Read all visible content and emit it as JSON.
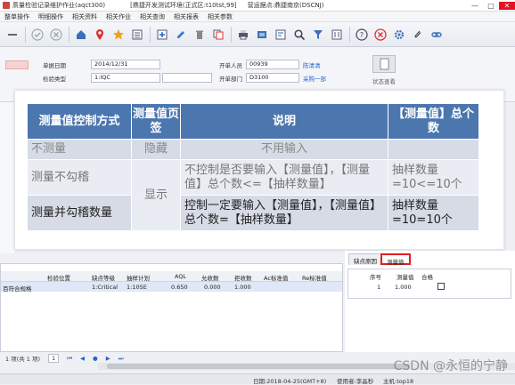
{
  "titlebar": {
    "title": "质量检验记录维护作业(aqct300)",
    "env": "[鼎捷开发测试环境(正式区:t10tst,99]",
    "site": "营运据点:鼎捷南京(DSCNJ)",
    "controls": [
      "—",
      "□",
      "✕"
    ]
  },
  "menu": [
    "整单操作",
    "明细操作",
    "相关资料",
    "相关作业",
    "相关查询",
    "相关报表",
    "相关参数"
  ],
  "toolbar": {
    "icons": [
      "minimize-icon",
      "check-icon",
      "cancel-icon",
      "home-icon",
      "locate-icon",
      "star-icon",
      "list-icon",
      "add-icon",
      "edit-icon",
      "delete-icon",
      "copy-icon",
      "print-icon",
      "export-icon",
      "query-icon",
      "search-icon",
      "filter-icon",
      "sort-icon",
      "help-icon",
      "error-icon",
      "settings-icon",
      "attach-icon",
      "link-icon"
    ]
  },
  "header": {
    "doc_date_label": "单据日期",
    "doc_date": "2014/12/31",
    "inspect_type_label": "检验类型",
    "inspect_type": "1:IQC",
    "opener_label": "开单人员",
    "opener_code": "00939",
    "opener_name": "陈清清",
    "dept_label": "开单部门",
    "dept_code": "D3100",
    "dept_name": "采购一部",
    "side_button": "状态查看"
  },
  "overlay": {
    "headers": [
      "测量值控制方式",
      "测量值页签",
      "说明",
      "【测量值】总个数"
    ],
    "rows": [
      [
        "不测量",
        "隐藏",
        "不用输入",
        ""
      ],
      [
        "测量不勾稽",
        "显示",
        "不控制是否要输入【测量值】，【测量值】总个数<=【抽样数量】",
        "抽样数量=10<=10个"
      ],
      [
        "测量并勾稽数量",
        "",
        "控制一定要输入【测量值】，【测量值】总个数=【抽样数量】",
        "抽样数量=10=10个"
      ]
    ]
  },
  "left_grid": {
    "columns": [
      "检验位置",
      "缺点等级",
      "抽样计划",
      "AQL",
      "允收数",
      "拒收数",
      "Ac标准值",
      "Re标准值"
    ],
    "rows": [
      [
        "百符合规格",
        "1:Critical",
        "1:105E",
        "0.650",
        "0.000",
        "1.000",
        "",
        ""
      ]
    ]
  },
  "right_panel": {
    "tabs": [
      "缺点原因",
      "测量值"
    ],
    "active_tab": 1,
    "columns": [
      "序号",
      "测量值",
      "合格"
    ],
    "rows": [
      {
        "seq": "1",
        "value": "1.000",
        "pass": false
      }
    ]
  },
  "pager": {
    "summary": "1 项(共 1 项)",
    "page": "1",
    "nav": [
      "⏮",
      "◀",
      "●",
      "▶",
      "⏭"
    ]
  },
  "statusbar": {
    "date": "日期:2018-04-25(GMT+8)",
    "user": "使用者:李晶秒",
    "host": "主机:top18"
  },
  "watermark": "CSDN @永恒的宁静"
}
